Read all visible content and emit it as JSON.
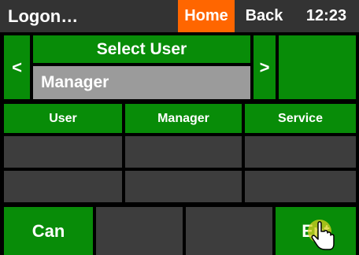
{
  "topbar": {
    "title": "Logon…",
    "home_label": "Home",
    "back_label": "Back",
    "clock": "12:23"
  },
  "user_select": {
    "prev_label": "<",
    "title": "Select User",
    "value": "Manager",
    "next_label": ">"
  },
  "tabs": [
    "User",
    "Manager",
    "Service"
  ],
  "footer": {
    "cancel_label": "Can",
    "enter_label": "Ent"
  },
  "colors": {
    "green": "#088c08",
    "orange": "#ff6600",
    "dark_cell": "#3d3d3d",
    "field_gray": "#9b9b9b"
  },
  "icons": {
    "cursor": "hand-pointer-icon"
  }
}
